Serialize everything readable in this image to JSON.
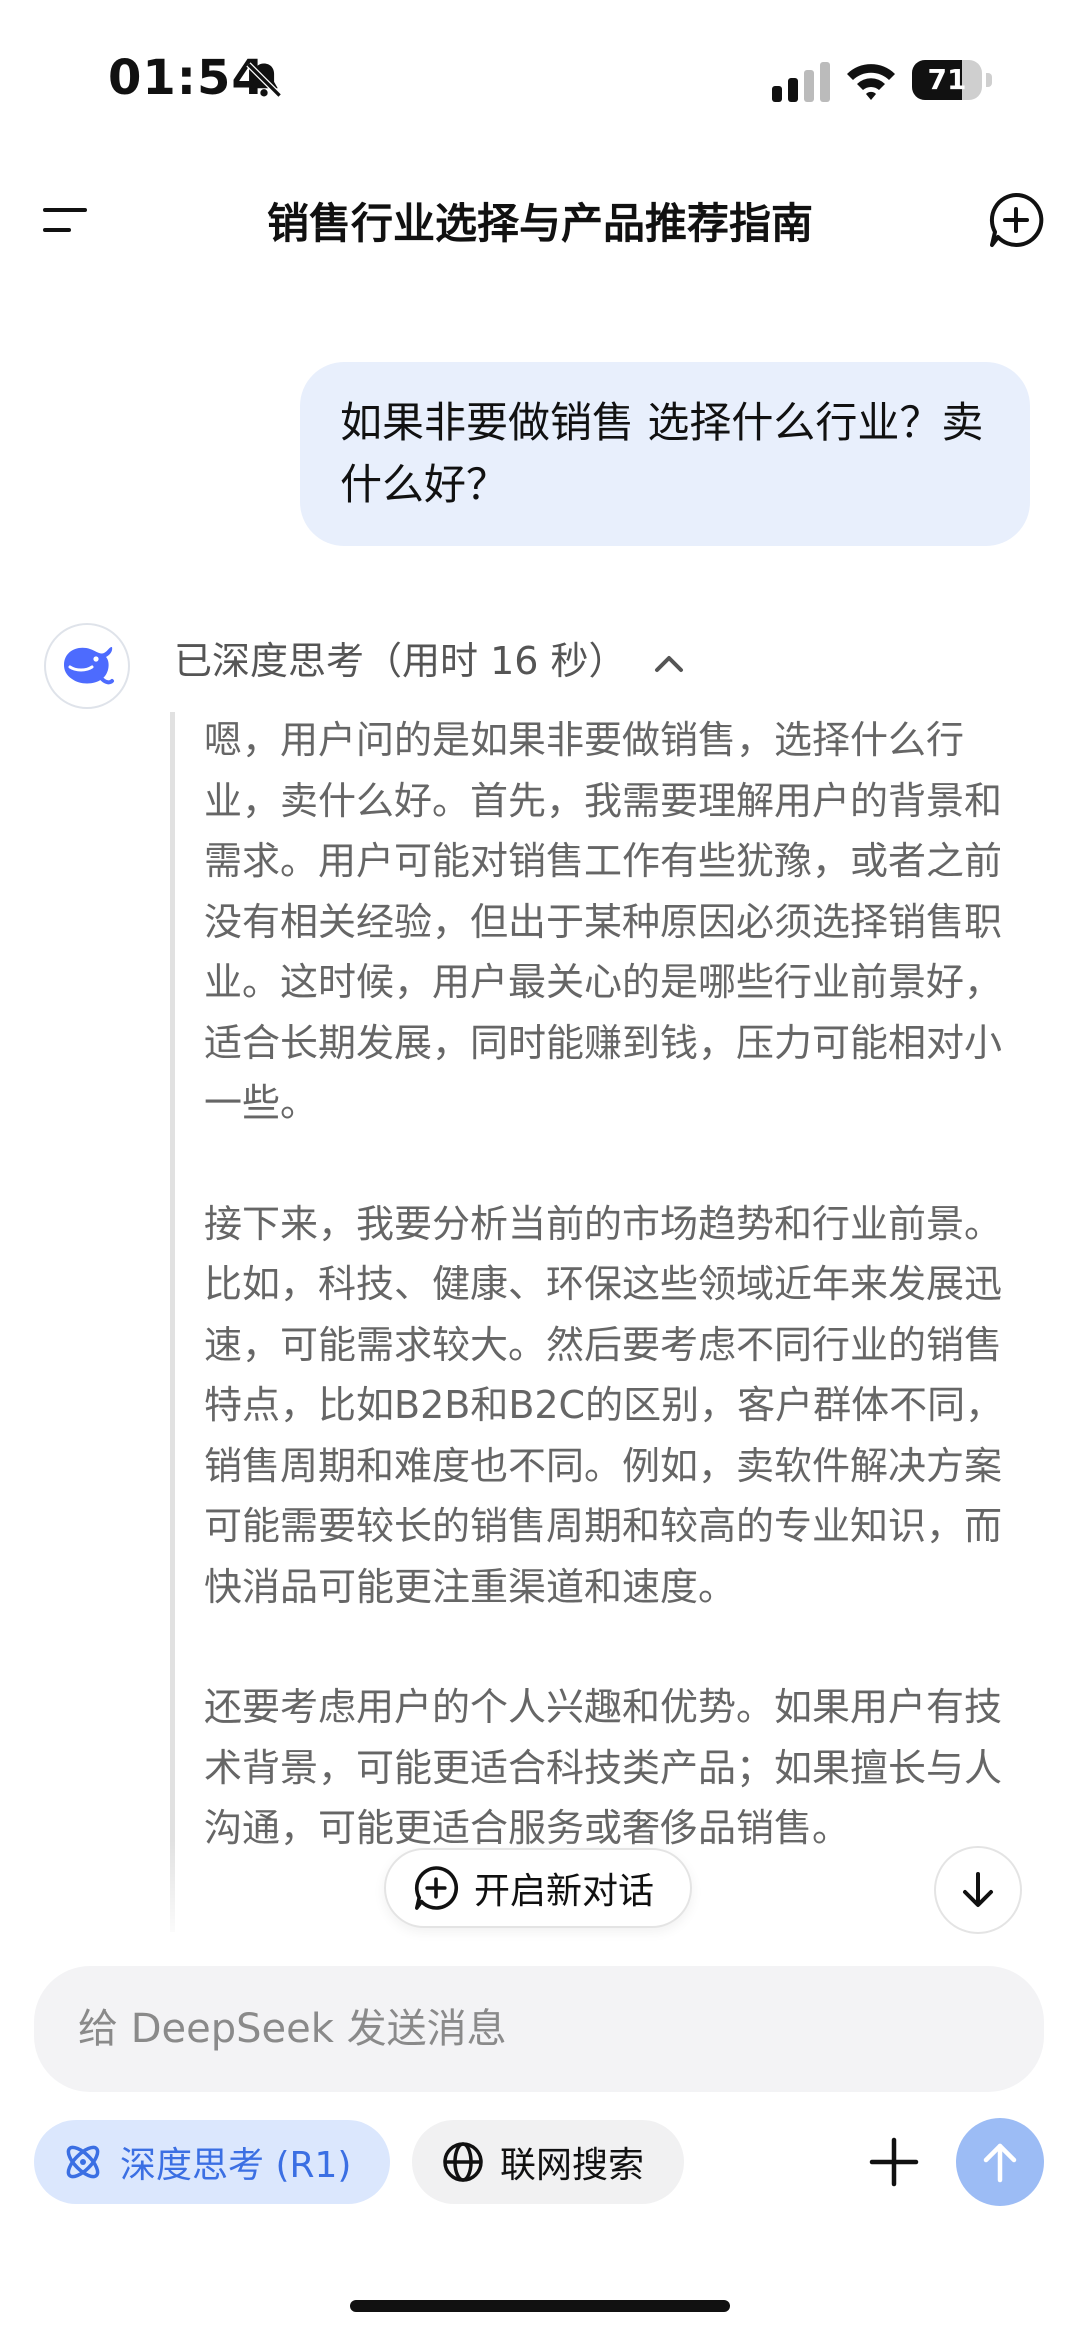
{
  "status_bar": {
    "time": "01:54",
    "battery": "71",
    "battery_level": 0.71,
    "icons": [
      "bell-off-icon",
      "signal-icon",
      "wifi-icon",
      "battery-icon"
    ]
  },
  "nav": {
    "title": "销售行业选择与产品推荐指南",
    "icons": [
      "menu-icon",
      "new-chat-icon"
    ]
  },
  "chat": {
    "user_message": "如果非要做销售 选择什么行业？卖什么好？",
    "thinking_header": "已深度思考（用时 16 秒）",
    "thinking_paragraphs": [
      "嗯，用户问的是如果非要做销售，选择什么行业，卖什么好。首先，我需要理解用户的背景和需求。用户可能对销售工作有些犹豫，或者之前没有相关经验，但出于某种原因必须选择销售职业。这时候，用户最关心的是哪些行业前景好，适合长期发展，同时能赚到钱，压力可能相对小一些。",
      "接下来，我要分析当前的市场趋势和行业前景。比如，科技、健康、环保这些领域近年来发展迅速，可能需求较大。然后要考虑不同行业的销售特点，比如B2B和B2C的区别，客户群体不同，销售周期和难度也不同。例如，卖软件解决方案可能需要较长的销售周期和较高的专业知识，而快消品可能更注重渠道和速度。",
      "还要考虑用户的个人兴趣和优势。如果用户有技术背景，可能更适合科技类产品；如果擅长与人沟通，可能更适合服务或奢侈品销售。"
    ],
    "new_chat_button": "开启新对话"
  },
  "composer": {
    "placeholder": "给 DeepSeek 发送消息",
    "deep_think_label": "深度思考 (R1)",
    "web_search_label": "联网搜索"
  },
  "colors": {
    "accent": "#4d6bfe",
    "user_bubble": "#e8effc",
    "chip_active_bg": "#dbe7fd",
    "chip_active_text": "#3b6fe3",
    "send_disabled": "#9cbcf5"
  }
}
